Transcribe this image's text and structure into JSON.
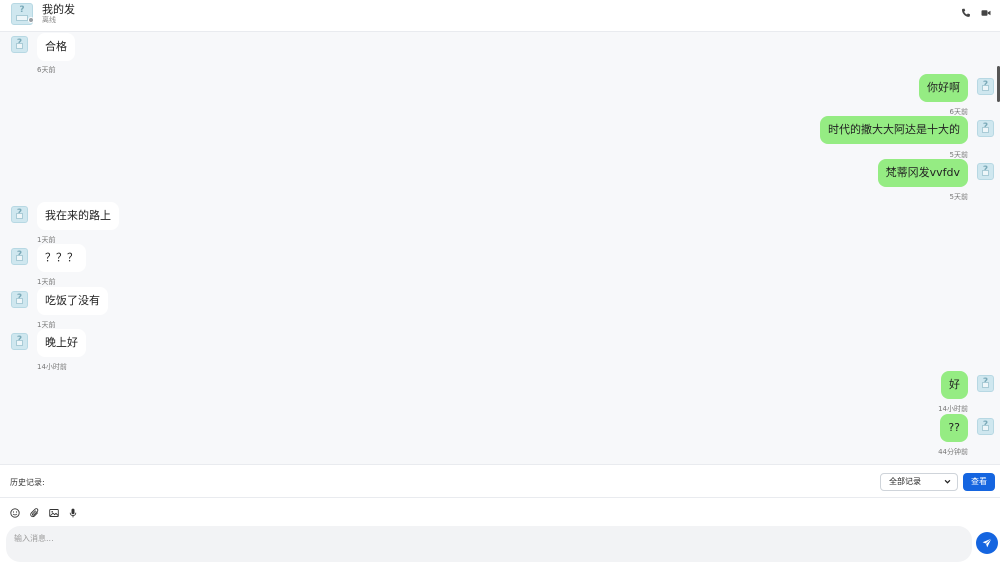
{
  "header": {
    "contact_name": "我的发",
    "contact_status": "离线",
    "icons": [
      "phone-icon",
      "video-icon"
    ]
  },
  "messages": [
    {
      "side": "in",
      "text": "合格",
      "time": "6天前"
    },
    {
      "side": "out",
      "text": "你好啊",
      "time": "6天前"
    },
    {
      "side": "out",
      "text": "时代的撒大大阿达是十大的",
      "time": "5天前"
    },
    {
      "side": "out",
      "text": "梵蒂冈发vvfdv",
      "time": "5天前"
    },
    {
      "side": "in",
      "text": "我在来的路上",
      "time": "1天前"
    },
    {
      "side": "in",
      "text": "？？？",
      "time": "1天前"
    },
    {
      "side": "in",
      "text": "吃饭了没有",
      "time": "1天前"
    },
    {
      "side": "in",
      "text": "晚上好",
      "time": "14小时前"
    },
    {
      "side": "out",
      "text": "好",
      "time": "14小时前"
    },
    {
      "side": "out",
      "text": "??",
      "time": "44分钟前"
    }
  ],
  "history": {
    "label": "历史记录:",
    "filter_value": "全部记录",
    "view_label": "查看"
  },
  "composer": {
    "placeholder": "输入消息...",
    "tools": [
      "emoji-icon",
      "attachment-icon",
      "image-icon",
      "microphone-icon"
    ]
  },
  "colors": {
    "outgoing_bubble": "#95ec83",
    "incoming_bubble": "#ffffff",
    "accent": "#1565e0"
  }
}
